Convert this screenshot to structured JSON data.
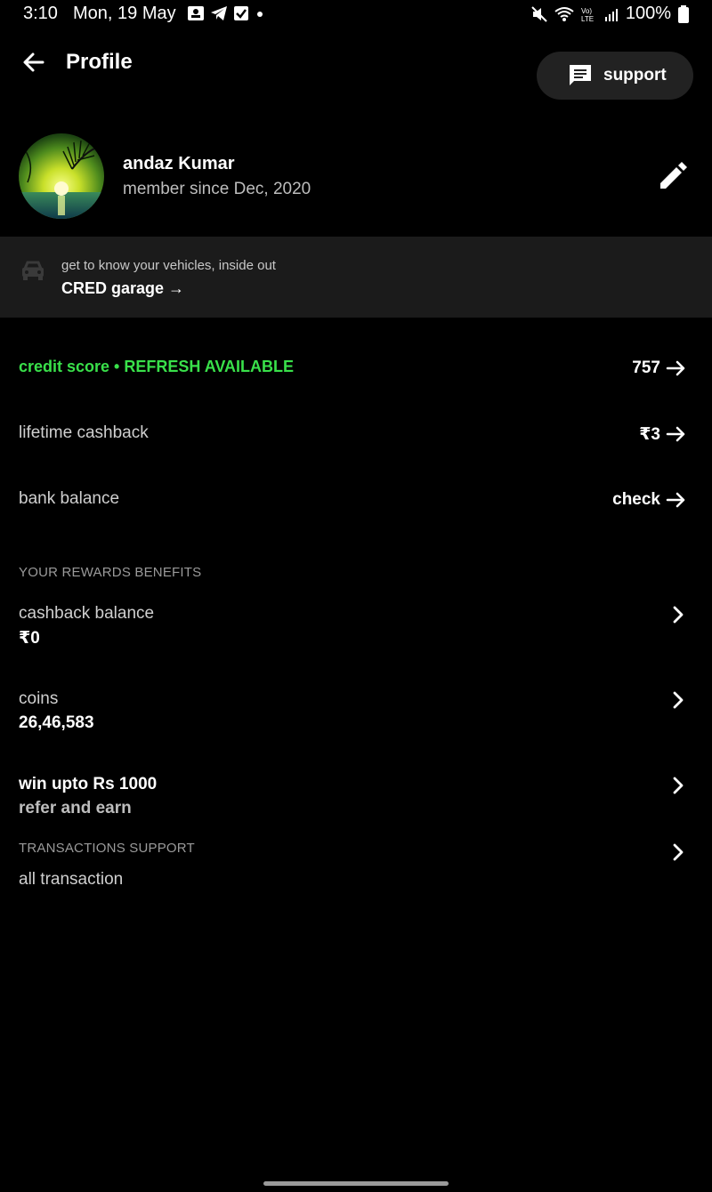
{
  "status_bar": {
    "time": "3:10",
    "date": "Mon, 19 May",
    "battery": "100%",
    "icons": [
      "notification-app-icon",
      "telegram-icon",
      "checkbox-icon",
      "dot-icon",
      "mute-icon",
      "wifi-icon",
      "volte-icon",
      "signal-icon",
      "battery-icon"
    ]
  },
  "header": {
    "title": "Profile",
    "support_label": "support"
  },
  "profile": {
    "name": "andaz Kumar",
    "member_since": "member since Dec, 2020"
  },
  "garage": {
    "subtitle": "get to know your vehicles, inside out",
    "title": "CRED garage →"
  },
  "rows": {
    "credit_score": {
      "label": "credit score • REFRESH AVAILABLE",
      "value": "757"
    },
    "lifetime_cashback": {
      "label": "lifetime cashback",
      "value": "₹3"
    },
    "bank_balance": {
      "label": "bank balance",
      "value": "check"
    }
  },
  "rewards": {
    "section_title": "YOUR REWARDS  BENEFITS",
    "cashback_balance": {
      "label": "cashback balance",
      "value": "₹0"
    },
    "coins": {
      "label": "coins",
      "value": "26,46,583"
    },
    "refer": {
      "label": "win upto Rs 1000",
      "value": "refer and earn"
    }
  },
  "transactions": {
    "section_title": "TRANSACTIONS SUPPORT",
    "all_label": "all transaction"
  },
  "colors": {
    "background": "#000000",
    "accent_green": "#39e04a",
    "banner_bg": "#1b1b1b",
    "button_bg": "#222222"
  }
}
